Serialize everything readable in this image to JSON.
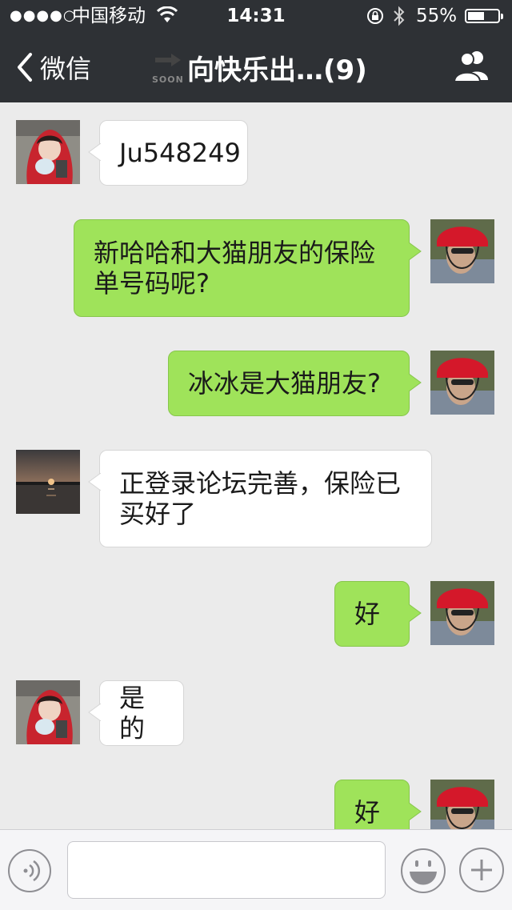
{
  "status_bar": {
    "signal": "●●●●○",
    "carrier": "中国移动",
    "time": "14:31",
    "battery": "55%",
    "battery_level": 0.55
  },
  "nav": {
    "back_label": "微信",
    "soon_label": "SOON",
    "title": "向快乐出…(9)"
  },
  "messages": [
    {
      "side": "in",
      "avatar": "girl-red-hood",
      "text": "Ju548249"
    },
    {
      "side": "out",
      "avatar": "man-red-helmet",
      "text": "新哈哈和大猫朋友的保险\n单号码呢?"
    },
    {
      "side": "out",
      "avatar": "man-red-helmet",
      "text": "冰冰是大猫朋友?"
    },
    {
      "side": "in",
      "avatar": "sunset-lake",
      "text": "正登录论坛完善，保险已\n买好了"
    },
    {
      "side": "out",
      "avatar": "man-red-helmet",
      "text": "好"
    },
    {
      "side": "in",
      "avatar": "girl-red-hood",
      "text": "是的"
    },
    {
      "side": "out",
      "avatar": "man-red-helmet",
      "text": "好"
    }
  ],
  "input": {
    "value": "",
    "placeholder": ""
  },
  "colors": {
    "nav_bg": "#2e3135",
    "chat_bg": "#ebebeb",
    "bubble_out": "#9fe35a",
    "bubble_in": "#ffffff"
  }
}
